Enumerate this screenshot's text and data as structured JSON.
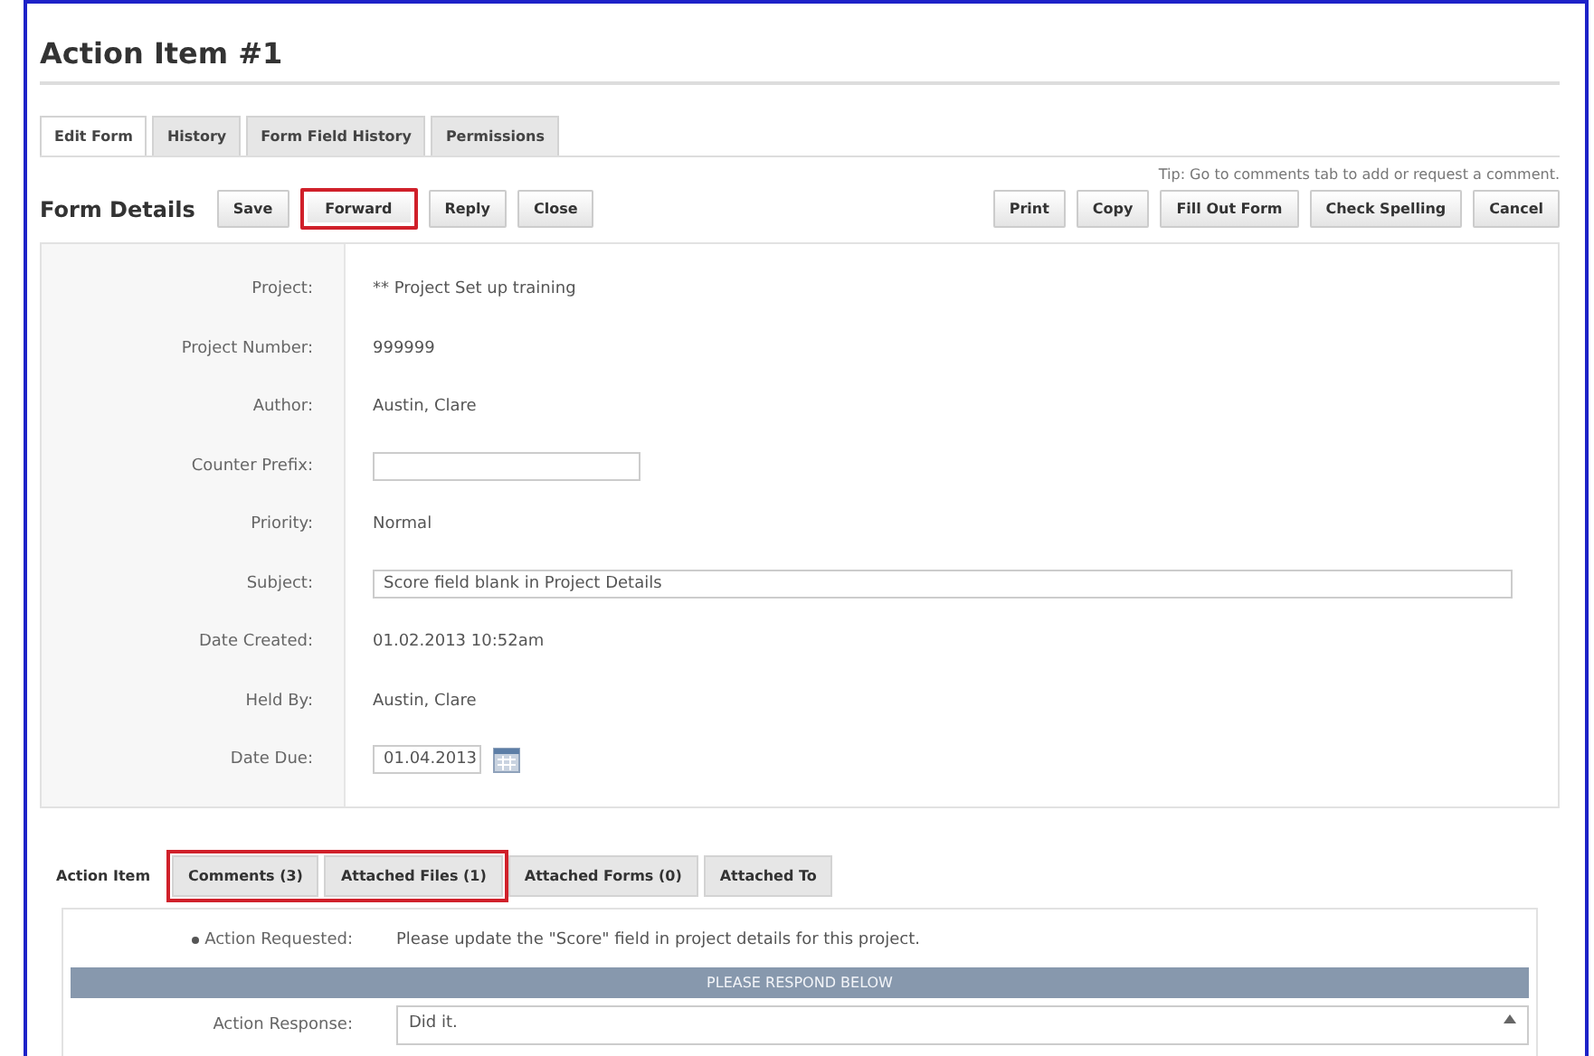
{
  "title": "Action Item #1",
  "tabs": [
    {
      "label": "Edit Form",
      "selected": true
    },
    {
      "label": "History",
      "selected": false
    },
    {
      "label": "Form Field History",
      "selected": false
    },
    {
      "label": "Permissions",
      "selected": false
    }
  ],
  "tip": "Tip: Go to comments tab to add or request a comment.",
  "form_details": {
    "heading": "Form Details",
    "left_buttons": [
      {
        "label": "Save",
        "highlighted": false
      },
      {
        "label": "Forward",
        "highlighted": true
      },
      {
        "label": "Reply",
        "highlighted": false
      },
      {
        "label": "Close",
        "highlighted": false
      }
    ],
    "right_buttons": [
      "Print",
      "Copy",
      "Fill Out Form",
      "Check Spelling",
      "Cancel"
    ]
  },
  "fields": [
    {
      "kind": "text",
      "label": "Project:",
      "value": "** Project Set up training"
    },
    {
      "kind": "text",
      "label": "Project Number:",
      "value": "999999"
    },
    {
      "kind": "text",
      "label": "Author:",
      "value": "Austin, Clare"
    },
    {
      "kind": "input",
      "label": "Counter Prefix:"
    },
    {
      "kind": "text",
      "label": "Priority:",
      "value": "Normal"
    },
    {
      "kind": "wide_input",
      "label": "Subject:",
      "value": "Score field blank in Project Details"
    },
    {
      "kind": "text",
      "label": "Date Created:",
      "value": "01.02.2013 10:52am"
    },
    {
      "kind": "text",
      "label": "Held By:",
      "value": "Austin, Clare"
    },
    {
      "kind": "date",
      "label": "Date Due:",
      "value": "01.04.2013"
    }
  ],
  "bottom_tabs": [
    {
      "label": "Action Item",
      "selected": true,
      "highlighted": false
    },
    {
      "label": "Comments (3)",
      "selected": false,
      "highlighted": true
    },
    {
      "label": "Attached Files (1)",
      "selected": false,
      "highlighted": true
    },
    {
      "label": "Attached Forms (0)",
      "selected": false,
      "highlighted": false
    },
    {
      "label": "Attached To",
      "selected": false,
      "highlighted": false
    }
  ],
  "action_item": {
    "requested_label": "Action Requested:",
    "requested_required": true,
    "requested_text": "Please update the \"Score\" field in project details for this project.",
    "banner": "PLEASE RESPOND BELOW",
    "response_label": "Action Response:",
    "response_value": "Did it."
  }
}
